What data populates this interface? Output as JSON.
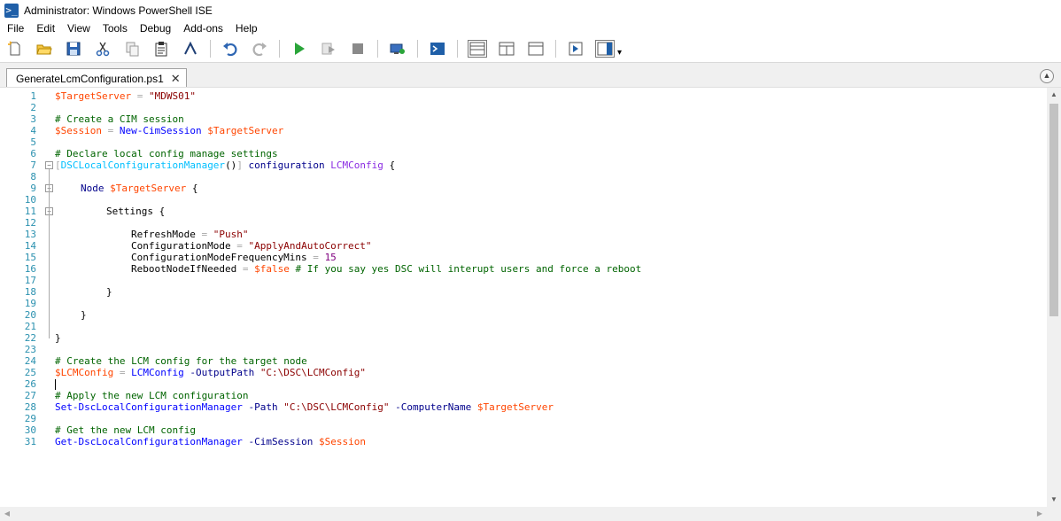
{
  "window": {
    "title": "Administrator: Windows PowerShell ISE"
  },
  "menu": [
    "File",
    "Edit",
    "View",
    "Tools",
    "Debug",
    "Add-ons",
    "Help"
  ],
  "toolbar": {
    "buttons": [
      "new-file-icon",
      "open-folder-icon",
      "save-icon",
      "cut-icon",
      "copy-icon",
      "paste-icon",
      "clear-console-icon",
      "undo-icon",
      "redo-icon",
      "run-script-icon",
      "run-selection-icon",
      "stop-icon",
      "new-remote-tab-icon",
      "start-powershell-icon",
      "script-pane-top-icon",
      "script-pane-right-icon",
      "script-pane-max-icon",
      "show-script-pane-icon",
      "show-commands-icon"
    ],
    "more": "▾"
  },
  "tab": {
    "label": "GenerateLcmConfiguration.ps1",
    "close": "✕"
  },
  "editor": {
    "lines": [
      {
        "n": "1"
      },
      {
        "n": "2"
      },
      {
        "n": "3"
      },
      {
        "n": "4"
      },
      {
        "n": "5"
      },
      {
        "n": "6"
      },
      {
        "n": "7"
      },
      {
        "n": "8"
      },
      {
        "n": "9"
      },
      {
        "n": "10"
      },
      {
        "n": "11"
      },
      {
        "n": "12"
      },
      {
        "n": "13"
      },
      {
        "n": "14"
      },
      {
        "n": "15"
      },
      {
        "n": "16"
      },
      {
        "n": "17"
      },
      {
        "n": "18"
      },
      {
        "n": "19"
      },
      {
        "n": "20"
      },
      {
        "n": "21"
      },
      {
        "n": "22"
      },
      {
        "n": "23"
      },
      {
        "n": "24"
      },
      {
        "n": "25"
      },
      {
        "n": "26"
      },
      {
        "n": "27"
      },
      {
        "n": "28"
      },
      {
        "n": "29"
      },
      {
        "n": "30"
      },
      {
        "n": "31"
      }
    ],
    "code": {
      "l1_var": "$TargetServer",
      "l1_eq": " = ",
      "l1_str": "\"MDWS01\"",
      "l3": "# Create a CIM session",
      "l4_var": "$Session",
      "l4_eq": " = ",
      "l4_cmd": "New-CimSession",
      "l4_sp": " ",
      "l4_var2": "$TargetServer",
      "l6": "# Declare local config manage settings",
      "l7_br1": "[",
      "l7_attr": "DSCLocalConfigurationManager",
      "l7_par": "()",
      "l7_br2": "]",
      "l7_kw": " configuration ",
      "l7_name": "LCMConfig",
      "l7_rest": " {",
      "l9_kw": "Node",
      "l9_sp": " ",
      "l9_var": "$TargetServer",
      "l9_rest": " {",
      "l11": "Settings {",
      "l13_k": "RefreshMode",
      "l13_eq": " = ",
      "l13_v": "\"Push\"",
      "l14_k": "ConfigurationMode",
      "l14_eq": " = ",
      "l14_v": "\"ApplyAndAutoCorrect\"",
      "l15_k": "ConfigurationModeFrequencyMins",
      "l15_eq": " = ",
      "l15_v": "15",
      "l16_k": "RebootNodeIfNeeded",
      "l16_eq": " = ",
      "l16_v": "$false",
      "l16_c": " # If you say yes DSC will interupt users and force a reboot",
      "l18": "}",
      "l20": "}",
      "l22": "}",
      "l24": "# Create the LCM config for the target node",
      "l25_var": "$LCMConfig",
      "l25_eq": " = ",
      "l25_cmd": "LCMConfig",
      "l25_param": " -OutputPath ",
      "l25_str": "\"C:\\DSC\\LCMConfig\"",
      "l27": "# Apply the new LCM configuration",
      "l28_cmd": "Set-DscLocalConfigurationManager",
      "l28_p1": " -Path ",
      "l28_str": "\"C:\\DSC\\LCMConfig\"",
      "l28_p2": " -ComputerName ",
      "l28_var": "$TargetServer",
      "l30": "# Get the new LCM config",
      "l31_cmd": "Get-DscLocalConfigurationManager",
      "l31_p": " -CimSession ",
      "l31_var": "$Session"
    }
  },
  "colors": {
    "accent": "#0078d7",
    "linenumber": "#2b91af",
    "variable": "#ff4500",
    "string": "#8b0000",
    "comment": "#006400",
    "command": "#0000ff"
  }
}
